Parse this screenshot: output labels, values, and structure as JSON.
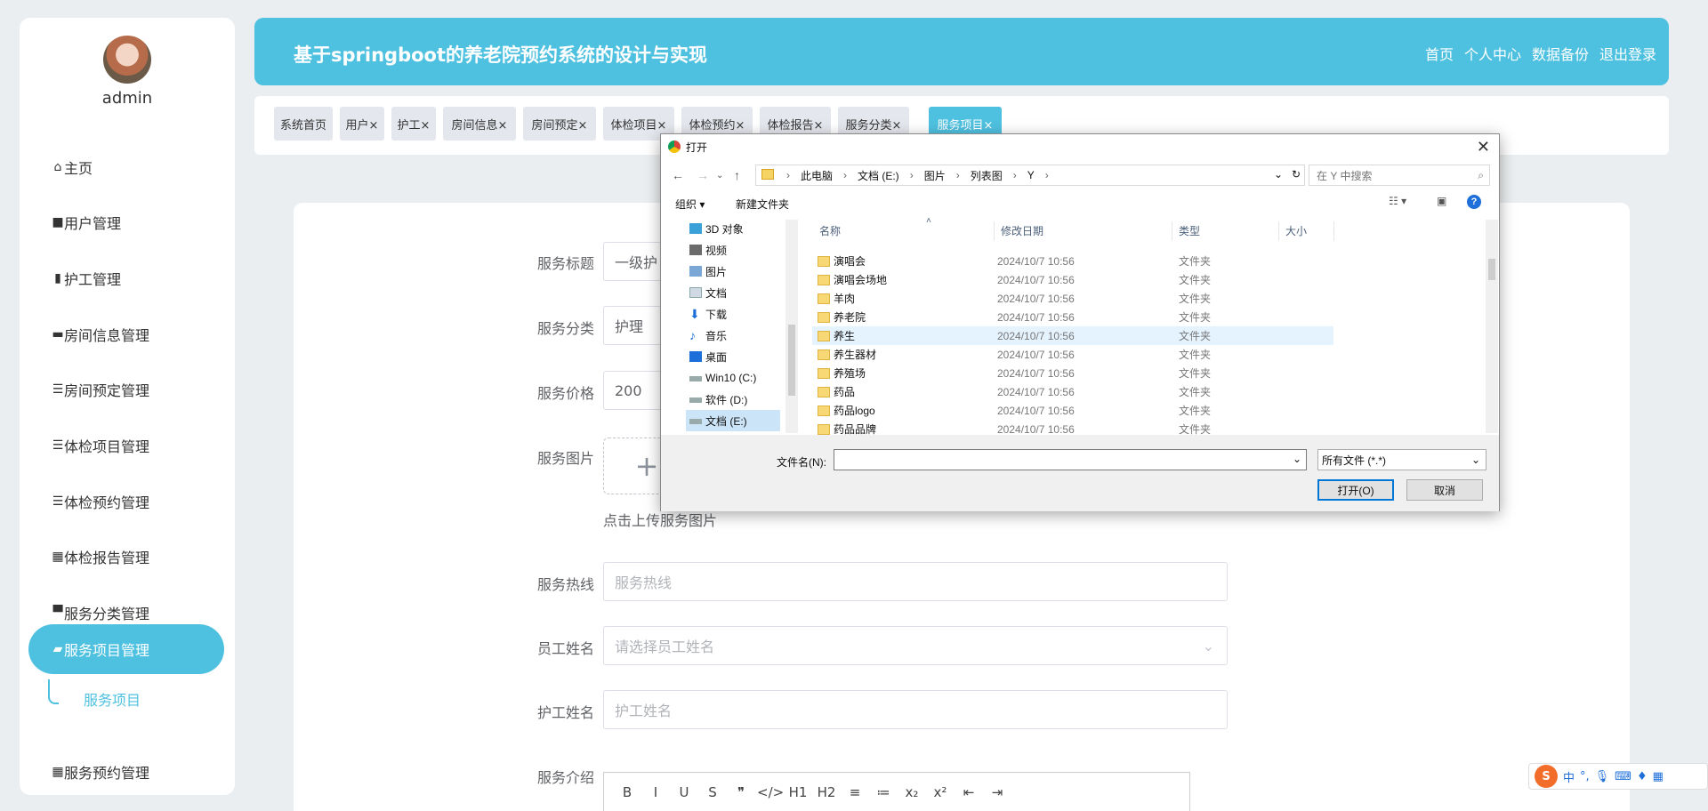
{
  "sidebar": {
    "username": "admin",
    "menu": [
      {
        "label": "主页",
        "icon": "home-icon"
      },
      {
        "label": "用户管理",
        "icon": "briefcase-icon"
      },
      {
        "label": "护工管理",
        "icon": "clipboard-icon"
      },
      {
        "label": "房间信息管理",
        "icon": "bed-icon"
      },
      {
        "label": "房间预定管理",
        "icon": "sliders-icon"
      },
      {
        "label": "体检项目管理",
        "icon": "list-icon"
      },
      {
        "label": "体检预约管理",
        "icon": "list-icon"
      },
      {
        "label": "体检报告管理",
        "icon": "grid-icon"
      },
      {
        "label": "服务分类管理",
        "icon": "monitor-icon"
      },
      {
        "label": "服务项目管理",
        "icon": "wallet-icon",
        "active": true
      },
      {
        "label": "服务预约管理",
        "icon": "grid-icon"
      }
    ],
    "submenu_label": "服务项目"
  },
  "header": {
    "title": "基于springboot的养老院预约系统的设计与实现",
    "nav": [
      "首页",
      "个人中心",
      "数据备份",
      "退出登录"
    ]
  },
  "tabs": [
    {
      "label": "系统首页"
    },
    {
      "label": "用户×"
    },
    {
      "label": "护工×"
    },
    {
      "label": "房间信息×"
    },
    {
      "label": "房间预定×"
    },
    {
      "label": "体检项目×"
    },
    {
      "label": "体检预约×"
    },
    {
      "label": "体检报告×"
    },
    {
      "label": "服务分类×"
    },
    {
      "label": "服务项目×",
      "active": true
    }
  ],
  "form": {
    "title_label": "服务标题",
    "title_value": "一级护",
    "category_label": "服务分类",
    "category_value": "护理",
    "price_label": "服务价格",
    "price_value": "200",
    "image_label": "服务图片",
    "image_plus": "+",
    "image_tip": "点击上传服务图片",
    "hotline_label": "服务热线",
    "hotline_placeholder": "服务热线",
    "staff_label": "员工姓名",
    "staff_placeholder": "请选择员工姓名",
    "nurse_label": "护工姓名",
    "nurse_placeholder": "护工姓名",
    "intro_label": "服务介绍",
    "editor_tools": [
      "B",
      "I",
      "U",
      "S",
      "❞",
      "</>",
      "H1",
      "H2",
      "≡",
      "≔",
      "x₂",
      "x²",
      "⇤",
      "⇥"
    ]
  },
  "dialog": {
    "title": "打开",
    "close": "✕",
    "breadcrumb": [
      "此电脑",
      "文档 (E:)",
      "图片",
      "列表图",
      "Y"
    ],
    "search_placeholder": "在 Y 中搜索",
    "organize": "组织 ▾",
    "new_folder": "新建文件夹",
    "help": "?",
    "nav_items": [
      {
        "label": "3D 对象",
        "icon": "cube-icon"
      },
      {
        "label": "视频",
        "icon": "video-icon"
      },
      {
        "label": "图片",
        "icon": "picture-icon"
      },
      {
        "label": "文档",
        "icon": "document-icon"
      },
      {
        "label": "下载",
        "icon": "download-icon"
      },
      {
        "label": "音乐",
        "icon": "music-icon"
      },
      {
        "label": "桌面",
        "icon": "desktop-icon"
      },
      {
        "label": "Win10 (C:)",
        "icon": "drive-icon"
      },
      {
        "label": "软件 (D:)",
        "icon": "drive-icon"
      },
      {
        "label": "文档 (E:)",
        "icon": "drive-icon",
        "selected": true
      }
    ],
    "columns": [
      "名称",
      "修改日期",
      "类型",
      "大小"
    ],
    "files": [
      {
        "name": "演唱会",
        "date": "2024/10/7 10:56",
        "type": "文件夹"
      },
      {
        "name": "演唱会场地",
        "date": "2024/10/7 10:56",
        "type": "文件夹"
      },
      {
        "name": "羊肉",
        "date": "2024/10/7 10:56",
        "type": "文件夹"
      },
      {
        "name": "养老院",
        "date": "2024/10/7 10:56",
        "type": "文件夹"
      },
      {
        "name": "养生",
        "date": "2024/10/7 10:56",
        "type": "文件夹",
        "hover": true
      },
      {
        "name": "养生器材",
        "date": "2024/10/7 10:56",
        "type": "文件夹"
      },
      {
        "name": "养殖场",
        "date": "2024/10/7 10:56",
        "type": "文件夹"
      },
      {
        "name": "药品",
        "date": "2024/10/7 10:56",
        "type": "文件夹"
      },
      {
        "name": "药品logo",
        "date": "2024/10/7 10:56",
        "type": "文件夹"
      },
      {
        "name": "药品品牌",
        "date": "2024/10/7 10:56",
        "type": "文件夹"
      }
    ],
    "filename_label": "文件名(N):",
    "filename_value": "",
    "filetype_value": "所有文件 (*.*)",
    "open_button": "打开(O)",
    "cancel_button": "取消"
  },
  "ime": {
    "label": "中"
  }
}
